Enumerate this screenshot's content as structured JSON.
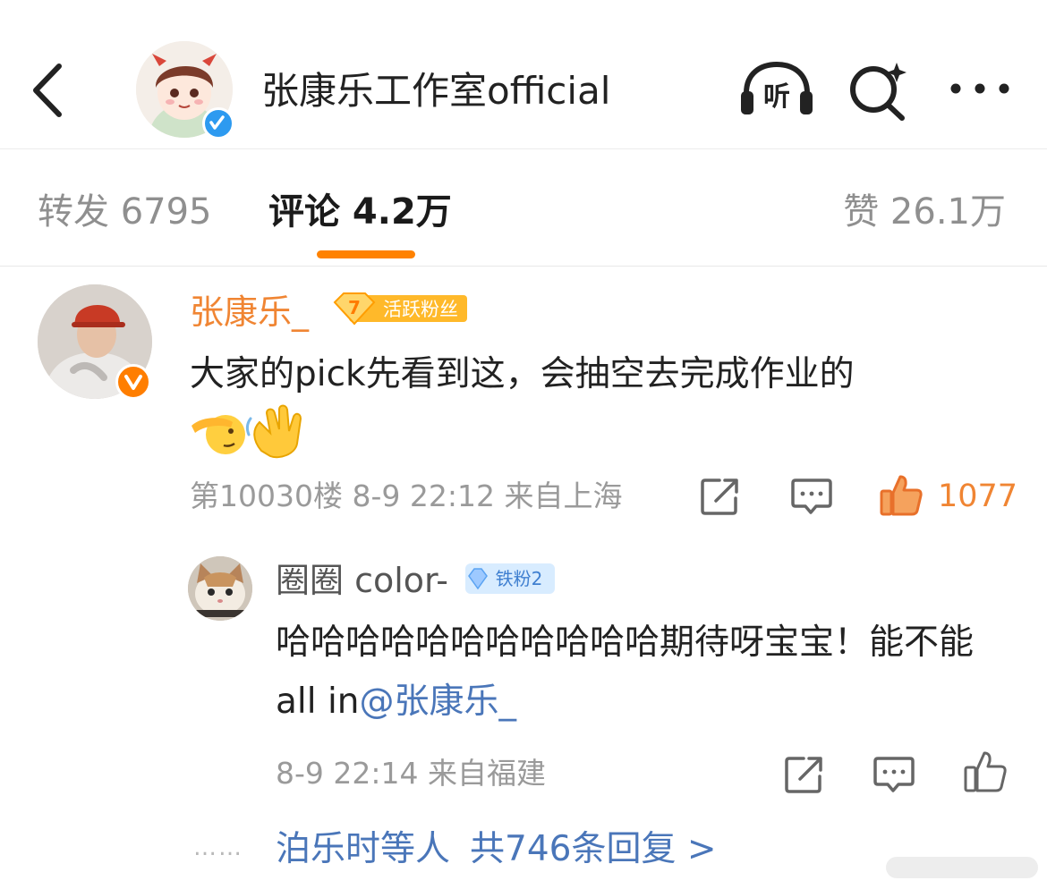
{
  "header": {
    "title": "张康乐工作室official",
    "listen_label": "听"
  },
  "tabs": {
    "repost": "转发 6795",
    "comments": "评论 4.2万",
    "likes": "赞 26.1万"
  },
  "comment": {
    "username": "张康乐_",
    "fan_level": "7",
    "fan_label": "活跃粉丝",
    "text": "大家的pick先看到这，会抽空去完成作业的",
    "meta": "第10030楼 8-9 22:12 来自上海",
    "like_count": "1077"
  },
  "reply": {
    "username": "圈圈 color-",
    "badge": "铁粉2",
    "text": "哈哈哈哈哈哈哈哈哈哈哈期待呀宝宝！能不能all in",
    "mention": "@张康乐_",
    "meta": "8-9 22:14 来自福建"
  },
  "more_replies": {
    "dots": "……",
    "users": "泊乐时等人",
    "count": "共746条回复 >"
  },
  "colors": {
    "accent_orange": "#ff8200",
    "username_orange": "#f08533",
    "link_blue": "#4a76b9",
    "muted_gray": "#9a9a9a"
  }
}
